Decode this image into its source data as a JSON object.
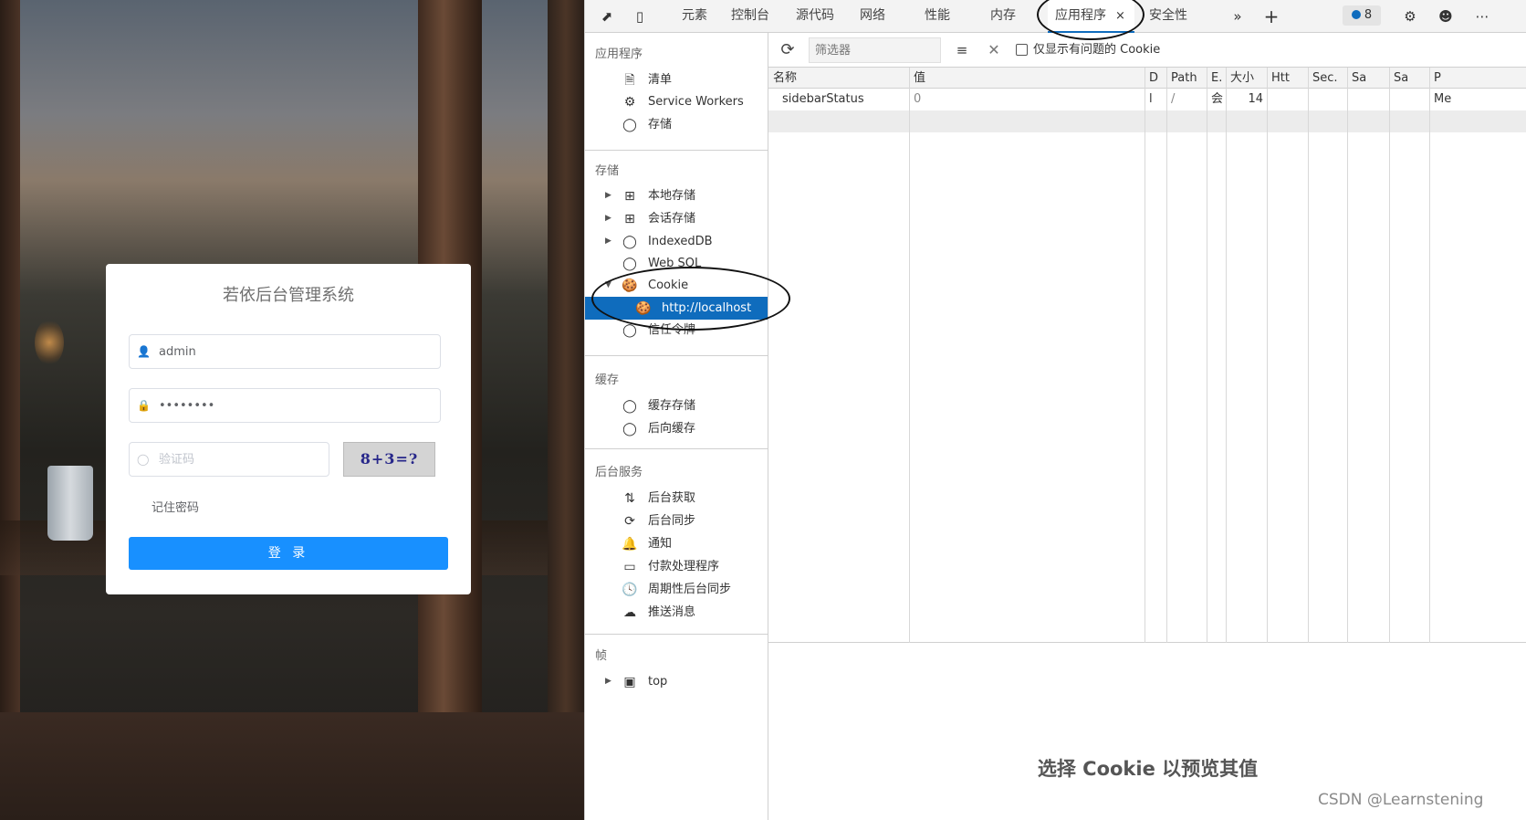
{
  "login": {
    "title": "若依后台管理系统",
    "username_value": "admin",
    "password_value": "••••••••",
    "captcha_placeholder": "验证码",
    "captcha_text": "8+3=?",
    "remember_label": "记住密码",
    "login_button": "登 录"
  },
  "devtools": {
    "tabs": [
      "元素",
      "控制台",
      "源代码",
      "网络",
      "性能",
      "内存",
      "应用程序",
      "安全性"
    ],
    "active_tab": "应用程序",
    "close_symbol": "×",
    "issues_count": "8",
    "toolbar": {
      "filter_placeholder": "筛选器",
      "issues_checkbox_label": "仅显示有问题的 Cookie"
    },
    "sidebar": {
      "sections": [
        {
          "title": "应用程序",
          "items": [
            "清单",
            "Service Workers",
            "存储"
          ]
        },
        {
          "title": "存储",
          "items": [
            "本地存储",
            "会话存储",
            "IndexedDB",
            "Web SQL",
            "Cookie",
            "http://localhost",
            "信任令牌"
          ]
        },
        {
          "title": "缓存",
          "items": [
            "缓存存储",
            "后向缓存"
          ]
        },
        {
          "title": "后台服务",
          "items": [
            "后台获取",
            "后台同步",
            "通知",
            "付款处理程序",
            "周期性后台同步",
            "推送消息"
          ]
        },
        {
          "title": "帧",
          "items": [
            "top"
          ]
        }
      ]
    },
    "cookie_table": {
      "columns": [
        "名称",
        "值",
        "D",
        "Path",
        "E.",
        "大小",
        "Htt",
        "Sec.",
        "Sa",
        "Sa",
        "P"
      ],
      "rows": [
        [
          "sidebarStatus",
          "0",
          "l",
          "/",
          "会",
          "14",
          "",
          "",
          "",
          "",
          "Me"
        ]
      ]
    },
    "preview_message": "选择 Cookie 以预览其值"
  },
  "watermark": "CSDN @Learnstening",
  "colors": {
    "accent": "#0f6cbd",
    "login_button": "#1890ff"
  }
}
